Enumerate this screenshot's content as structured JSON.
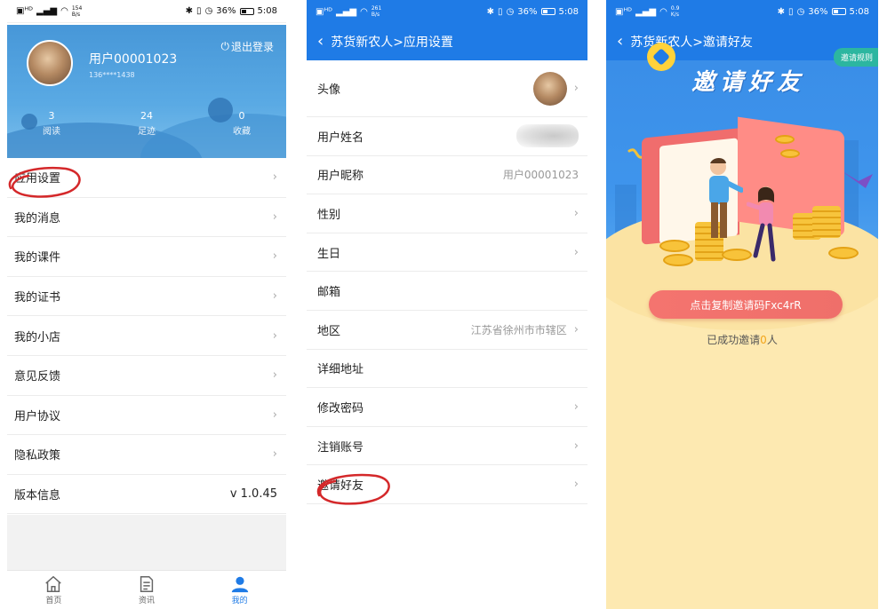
{
  "status": {
    "left_net": "154\nB/s",
    "left_net2": "261\nB/s",
    "left_net3": "0.9\nK/s",
    "battery": "36%",
    "time": "5:08"
  },
  "profile": {
    "username": "用户00001023",
    "phone": "136****1438",
    "logout_label": "退出登录",
    "stats": [
      {
        "value": "3",
        "label": "阅读"
      },
      {
        "value": "24",
        "label": "足迹"
      },
      {
        "value": "0",
        "label": "收藏"
      }
    ]
  },
  "menu": {
    "items": [
      {
        "label": "应用设置"
      },
      {
        "label": "我的消息"
      },
      {
        "label": "我的课件"
      },
      {
        "label": "我的证书"
      },
      {
        "label": "我的小店"
      },
      {
        "label": "意见反馈"
      },
      {
        "label": "用户协议"
      },
      {
        "label": "隐私政策"
      }
    ],
    "version_label": "版本信息",
    "version_value": "v 1.0.45"
  },
  "tabbar": {
    "tabs": [
      {
        "label": "首页"
      },
      {
        "label": "资讯"
      },
      {
        "label": "我的"
      }
    ]
  },
  "settings": {
    "nav_title": "苏货新农人>应用设置",
    "rows": [
      {
        "label": "头像",
        "value": ""
      },
      {
        "label": "用户姓名",
        "value": ""
      },
      {
        "label": "用户昵称",
        "value": "用户00001023"
      },
      {
        "label": "性别",
        "value": ""
      },
      {
        "label": "生日",
        "value": ""
      },
      {
        "label": "邮箱",
        "value": ""
      },
      {
        "label": "地区",
        "value": "江苏省徐州市市辖区"
      },
      {
        "label": "详细地址",
        "value": ""
      },
      {
        "label": "修改密码",
        "value": ""
      },
      {
        "label": "注销账号",
        "value": ""
      },
      {
        "label": "邀请好友",
        "value": ""
      }
    ]
  },
  "invite": {
    "nav_title": "苏货新农人>邀请好友",
    "title": "邀请好友",
    "rules_label": "邀请规则",
    "button_label": "点击复制邀请码Fxc4rR",
    "count_prefix": "已成功邀请",
    "count_value": "0",
    "count_suffix": "人"
  },
  "colors": {
    "primary_blue": "#1f7be6",
    "annotation_red": "#d4282a",
    "invite_bg": "#fde9b1",
    "invite_button": "#f4746f"
  }
}
